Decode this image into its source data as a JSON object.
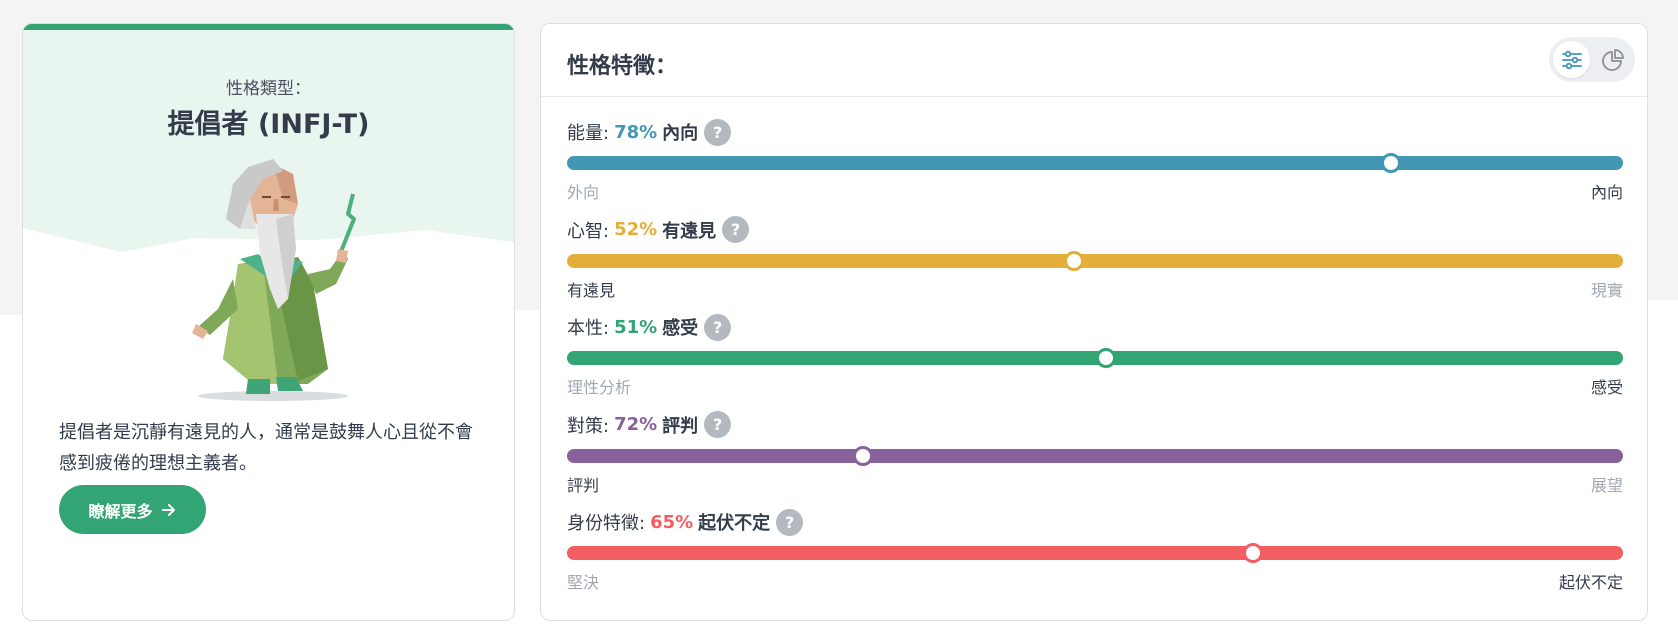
{
  "type_card": {
    "label": "性格類型：",
    "name": "提倡者 (INFJ-T)",
    "description": "提倡者是沉靜有遠見的人，通常是鼓舞人心且從不會感到疲倦的理想主義者。",
    "learn_more": "瞭解更多",
    "learn_more_icon": "arrow-right-icon",
    "accent_color": "#33a474"
  },
  "traits": {
    "title": "性格特徵：",
    "view_toggle": [
      "sliders-icon",
      "pie-chart-icon"
    ],
    "items": [
      {
        "name": "能量:",
        "percent": "78%",
        "side": "內向",
        "left_label": "外向",
        "right_label": "內向",
        "value": 78,
        "dominant": "right",
        "color": "#4298b4"
      },
      {
        "name": "心智:",
        "percent": "52%",
        "side": "有遠見",
        "left_label": "有遠見",
        "right_label": "現實",
        "value": 52,
        "dominant": "left",
        "color": "#e4ae3a"
      },
      {
        "name": "本性:",
        "percent": "51%",
        "side": "感受",
        "left_label": "理性分析",
        "right_label": "感受",
        "value": 51,
        "dominant": "right",
        "color": "#33a474"
      },
      {
        "name": "對策:",
        "percent": "72%",
        "side": "評判",
        "left_label": "評判",
        "right_label": "展望",
        "value": 72,
        "dominant": "left",
        "color": "#88619a"
      },
      {
        "name": "身份特徵:",
        "percent": "65%",
        "side": "起伏不定",
        "left_label": "堅決",
        "right_label": "起伏不定",
        "value": 65,
        "dominant": "right",
        "color": "#f25e62"
      }
    ]
  }
}
